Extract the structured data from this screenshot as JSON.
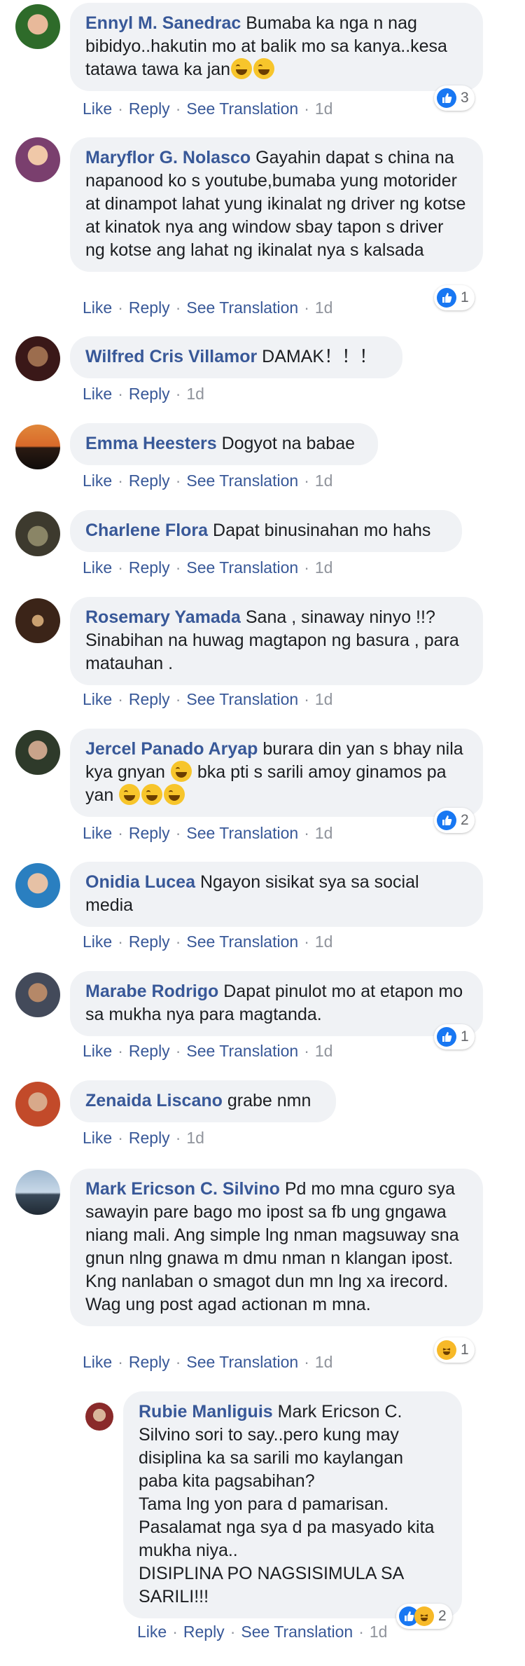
{
  "actions": {
    "like": "Like",
    "reply": "Reply",
    "see_translation": "See Translation",
    "separator": "·"
  },
  "comments": [
    {
      "author": "Ennyl M. Sanedrac",
      "text": "Bumaba ka nga n nag bibidyo..hakutin mo at balik mo sa kanya..kesa tatawa tawa ka jan",
      "age": "1d",
      "reaction_count": "3"
    },
    {
      "author": "Maryflor G. Nolasco",
      "text": "Gayahin dapat s china na napanood ko s youtube,bumaba yung motorider at dinampot lahat yung ikinalat ng driver ng kotse at kinatok nya ang window sbay tapon s driver ng kotse ang lahat ng ikinalat nya s kalsada",
      "age": "1d",
      "reaction_count": "1"
    },
    {
      "author": "Wilfred Cris Villamor",
      "text": "DAMAK！！！",
      "age": "1d"
    },
    {
      "author": "Emma Heesters",
      "text": "Dogyot na babae",
      "age": "1d"
    },
    {
      "author": "Charlene Flora",
      "text": "Dapat binusinahan mo hahs",
      "age": "1d"
    },
    {
      "author": "Rosemary Yamada",
      "text": "Sana , sinaway ninyo !!? Sinabihan na huwag magtapon ng basura , para matauhan .",
      "age": "1d"
    },
    {
      "author": "Jercel Panado Aryap",
      "text_a": "burara din yan s bhay nila kya gnyan",
      "text_b": "bka pti s sarili amoy ginamos pa yan",
      "age": "1d",
      "reaction_count": "2"
    },
    {
      "author": "Onidia Lucea",
      "text": "Ngayon sisikat sya sa social media",
      "age": "1d"
    },
    {
      "author": "Marabe Rodrigo",
      "text": "Dapat pinulot mo at etapon mo sa mukha nya para magtanda.",
      "age": "1d",
      "reaction_count": "1"
    },
    {
      "author": "Zenaida Liscano",
      "text": "grabe nmn",
      "age": "1d"
    },
    {
      "author": "Mark Ericson C. Silvino",
      "text": "Pd mo mna cguro sya sawayin pare bago mo ipost sa fb ung gngawa niang mali. Ang simple lng nman magsuway sna gnun nlng gnawa m dmu nman n klangan ipost. Kng nanlaban o smagot dun mn lng xa irecord. Wag ung post agad actionan m mna.",
      "age": "1d",
      "reaction_count": "1"
    },
    {
      "author": "Rubie Manliguis",
      "text_a": "Mark Ericson C. Silvino sori to say..pero kung may disiplina ka sa sarili mo kaylangan paba kita pagsabihan?",
      "text_b": "Tama lng yon para d pamarisan.",
      "text_c": "Pasalamat nga sya d pa masyado kita mukha niya..",
      "text_d": "DISIPLINA PO NAGSISIMULA SA SARILI!!!",
      "age": "1d",
      "reaction_count": "2"
    }
  ],
  "colors": {
    "author": "#385898",
    "bubble": "#f0f2f5",
    "like": "#1877f2",
    "haha": "#f7b928",
    "meta": "#90949c"
  }
}
